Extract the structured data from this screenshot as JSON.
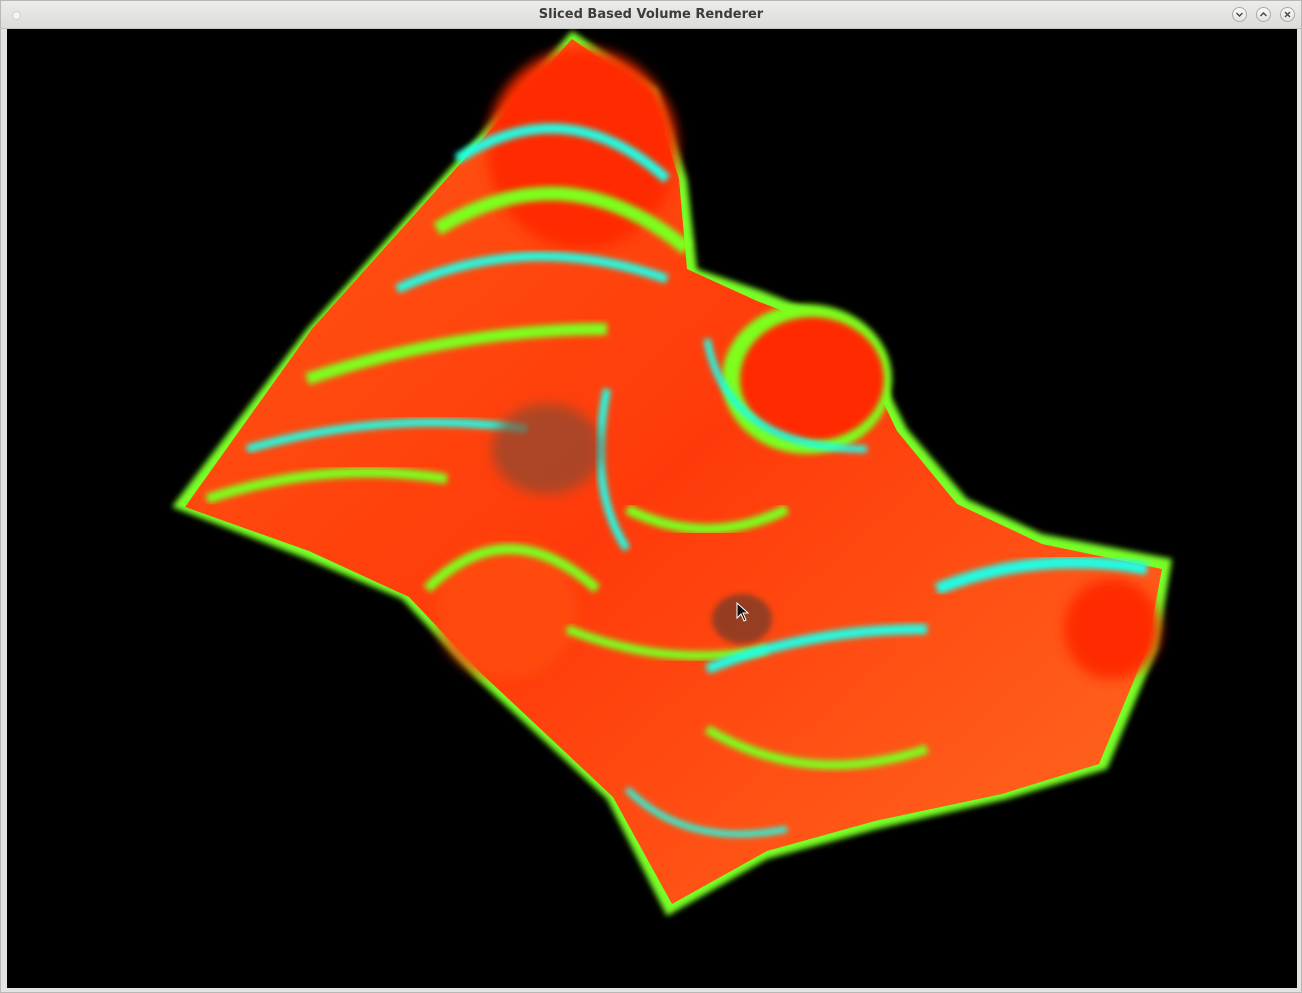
{
  "window": {
    "title": "Sliced Based Volume Renderer",
    "controls": [
      "minimize",
      "maximize",
      "close"
    ]
  },
  "render": {
    "background": "#000000",
    "colormap": [
      "#ff2a00",
      "#ff6a20",
      "#7dff1e",
      "#1effe6",
      "#0a2aff"
    ]
  }
}
